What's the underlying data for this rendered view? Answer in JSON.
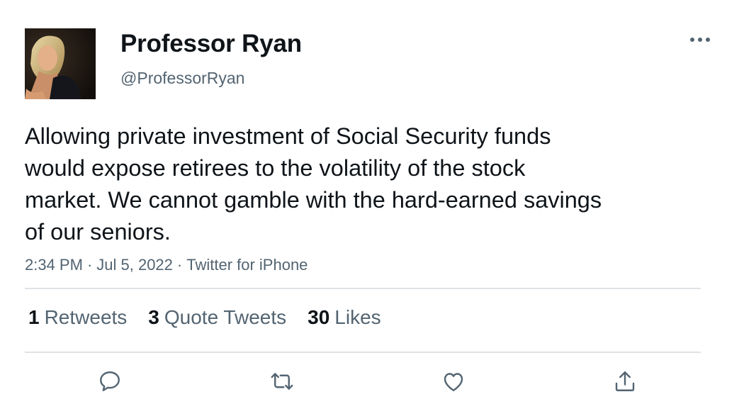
{
  "author": {
    "display_name": "Professor Ryan",
    "handle": "@ProfessorRyan",
    "avatar_icon": "profile-photo"
  },
  "more_icon": "ellipsis-icon",
  "tweet": {
    "text_lines": [
      "Allowing private investment of Social Security funds",
      "would expose retirees to the volatility of the stock",
      "market. We cannot gamble with the hard-earned savings",
      "of our seniors."
    ],
    "time": "2:34 PM",
    "date": "Jul 5, 2022",
    "source": "Twitter for iPhone",
    "separator": "·"
  },
  "stats": {
    "retweets": {
      "count": "1",
      "label": "Retweets"
    },
    "quote_tweets": {
      "count": "3",
      "label": "Quote Tweets"
    },
    "likes": {
      "count": "30",
      "label": "Likes"
    }
  },
  "actions": [
    {
      "name": "reply",
      "icon": "reply-icon"
    },
    {
      "name": "retweet",
      "icon": "retweet-icon"
    },
    {
      "name": "like",
      "icon": "heart-icon"
    },
    {
      "name": "share",
      "icon": "share-icon"
    }
  ],
  "colors": {
    "text_primary": "#0f1419",
    "text_secondary": "#536471",
    "divider": "#dfe3e6"
  }
}
